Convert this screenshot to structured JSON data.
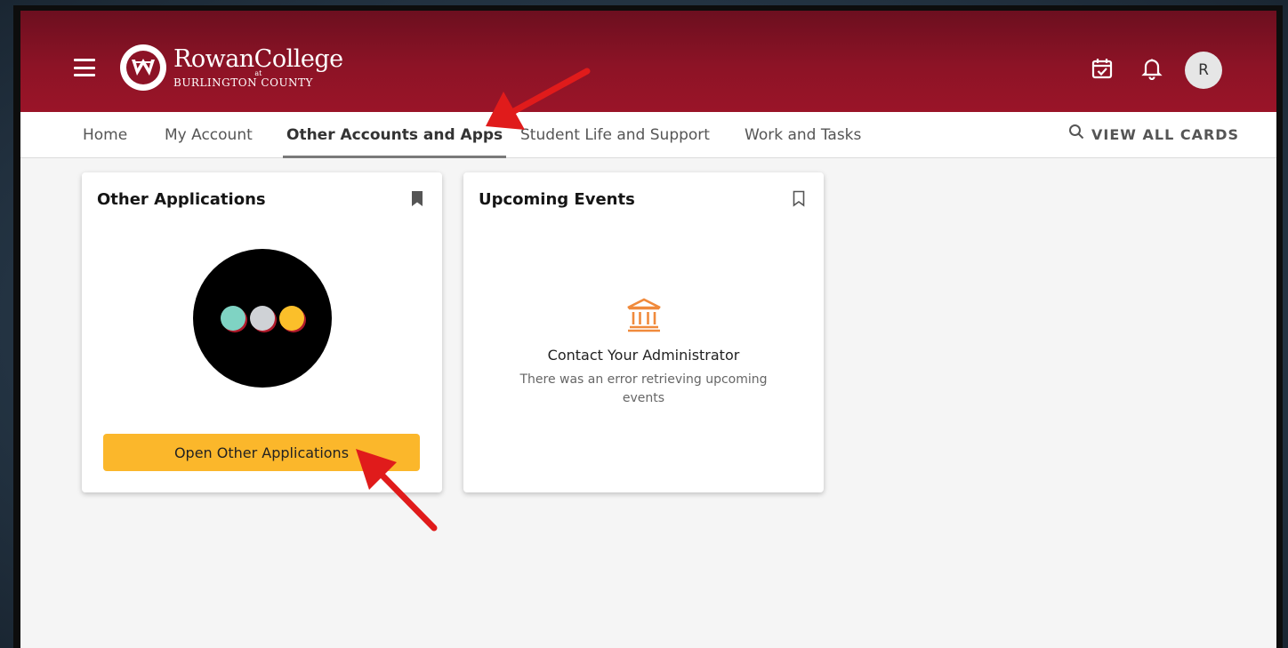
{
  "app": {
    "logo_name": "RowanCollege",
    "logo_at": "at",
    "logo_sub": "BURLINGTON COUNTY",
    "avatar_initial": "R"
  },
  "icons": {
    "menu": "hamburger-icon",
    "logo": "rcbc-logo-icon",
    "tasks": "calendar-check-icon",
    "notifications": "bell-icon",
    "search": "search-icon",
    "bookmark_filled": "bookmark-filled-icon",
    "bookmark_outline": "bookmark-outline-icon",
    "institution": "institution-icon"
  },
  "nav": {
    "items": [
      {
        "label": "Home"
      },
      {
        "label": "My Account"
      },
      {
        "label": "Other Accounts and Apps",
        "active": true
      },
      {
        "label": "Student Life and Support"
      },
      {
        "label": "Work and Tasks"
      }
    ],
    "view_all": "VIEW ALL CARDS"
  },
  "cards": {
    "other_apps": {
      "title": "Other Applications",
      "button": "Open Other Applications",
      "dot_colors": [
        "#7fd3c3",
        "#cfd2d6",
        "#fbbf2a"
      ]
    },
    "events": {
      "title": "Upcoming Events",
      "error_title": "Contact Your Administrator",
      "error_message": "There was an error retrieving upcoming events"
    }
  },
  "colors": {
    "header": "#8d1326",
    "button": "#fbb72b",
    "annotation_arrow": "#e01b1b",
    "institution_icon": "#f08a3c"
  }
}
